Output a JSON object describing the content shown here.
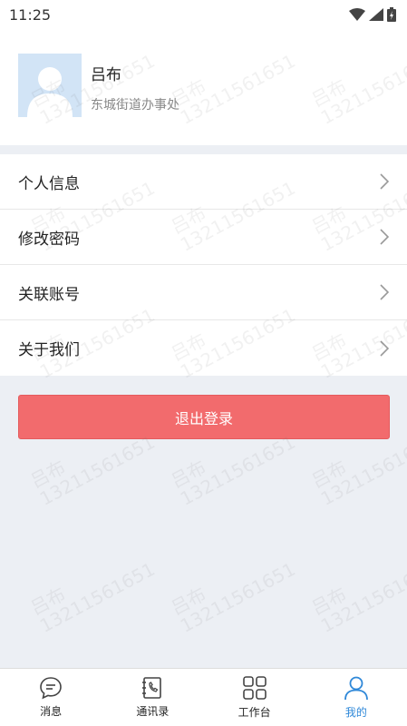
{
  "status_bar": {
    "time": "11:25"
  },
  "profile": {
    "name": "吕布",
    "department": "东城街道办事处"
  },
  "menu": {
    "items": [
      {
        "label": "个人信息"
      },
      {
        "label": "修改密码"
      },
      {
        "label": "关联账号"
      },
      {
        "label": "关于我们"
      }
    ]
  },
  "logout_label": "退出登录",
  "watermark": {
    "line1": "吕布",
    "line2": "13211561651"
  },
  "tabbar": {
    "items": [
      {
        "label": "消息",
        "icon": "chat-bubble-icon",
        "active": false
      },
      {
        "label": "通讯录",
        "icon": "contacts-book-icon",
        "active": false
      },
      {
        "label": "工作台",
        "icon": "grid-icon",
        "active": false
      },
      {
        "label": "我的",
        "icon": "user-icon",
        "active": true
      }
    ]
  },
  "colors": {
    "accent": "#2f88d8",
    "logout": "#f26b6d",
    "background": "#eceff4"
  }
}
